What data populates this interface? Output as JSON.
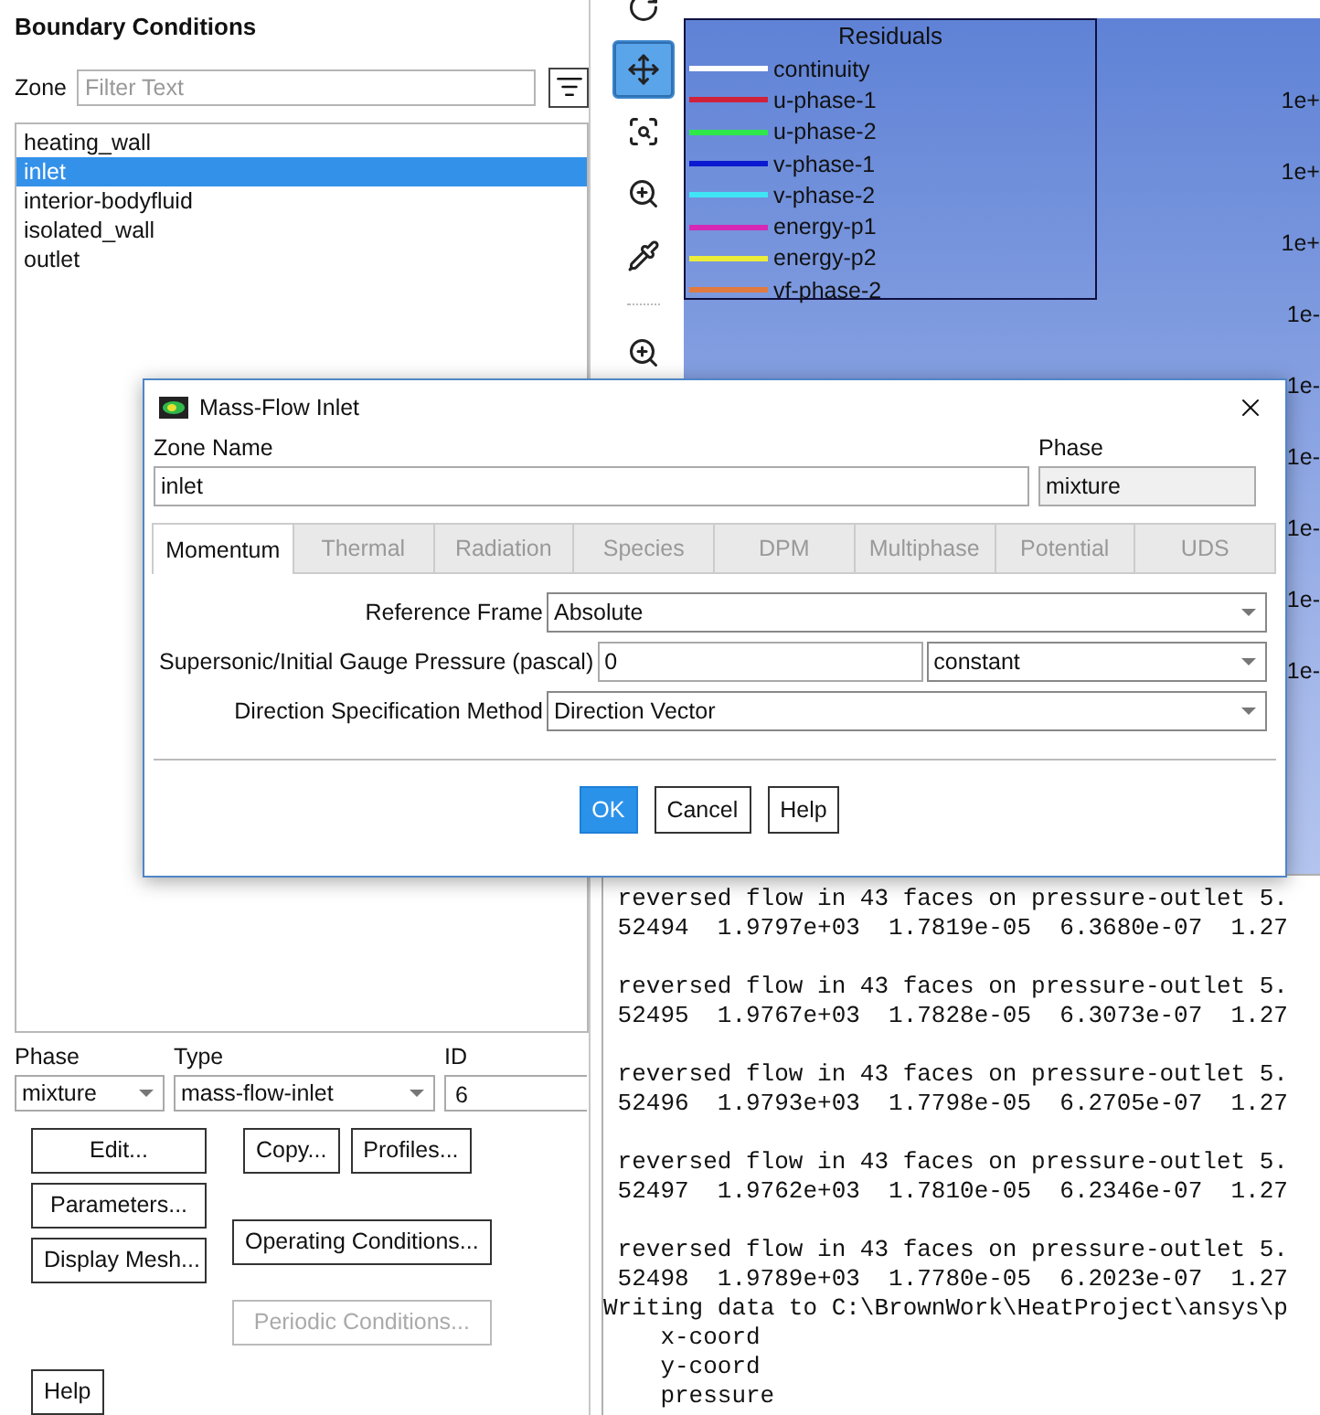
{
  "boundary_panel": {
    "title": "Boundary Conditions",
    "zone_label": "Zone",
    "filter": {
      "placeholder": "Filter Text"
    },
    "zones": [
      {
        "label": "heating_wall",
        "selected": false
      },
      {
        "label": "inlet",
        "selected": true
      },
      {
        "label": "interior-bodyfluid",
        "selected": false
      },
      {
        "label": "isolated_wall",
        "selected": false
      },
      {
        "label": "outlet",
        "selected": false
      }
    ],
    "phase": {
      "label": "Phase",
      "value": "mixture"
    },
    "type": {
      "label": "Type",
      "value": "mass-flow-inlet"
    },
    "id": {
      "label": "ID",
      "value": "6"
    },
    "buttons": [
      {
        "label": "Edit...",
        "disabled": false
      },
      {
        "label": "Parameters...",
        "disabled": false
      },
      {
        "label": "Display Mesh...",
        "disabled": false
      },
      {
        "label": "Copy...",
        "disabled": false
      },
      {
        "label": "Profiles...",
        "disabled": false
      },
      {
        "label": "Operating Conditions...",
        "disabled": false
      },
      {
        "label": "Periodic Conditions...",
        "disabled": true
      },
      {
        "label": "Help",
        "disabled": false
      }
    ]
  },
  "toolbar": [
    {
      "kind": "rotate",
      "selected": false
    },
    {
      "kind": "pan",
      "selected": true
    },
    {
      "kind": "zoom-fit",
      "selected": false
    },
    {
      "kind": "zoom-in",
      "selected": false
    },
    {
      "kind": "probe",
      "selected": false
    },
    {
      "kind": "separator"
    },
    {
      "kind": "zoom-box",
      "selected": false
    }
  ],
  "residuals_plot": {
    "legend_title": "Residuals",
    "legend": [
      {
        "label": "continuity",
        "color": "#ffffff"
      },
      {
        "label": "u-phase-1",
        "color": "#d0213a"
      },
      {
        "label": "u-phase-2",
        "color": "#2ee84a"
      },
      {
        "label": "v-phase-1",
        "color": "#0a1ad0"
      },
      {
        "label": "v-phase-2",
        "color": "#3fe5f5"
      },
      {
        "label": "energy-p1",
        "color": "#d628b4"
      },
      {
        "label": "energy-p2",
        "color": "#ecec3a"
      },
      {
        "label": "vf-phase-2",
        "color": "#e07a40"
      }
    ],
    "axis_labels": [
      "1e+",
      "1e+",
      "1e+",
      "1e-",
      "1e-",
      "1e-",
      "1e-",
      "1e-",
      "1e-"
    ]
  },
  "console": {
    "blocks": [
      {
        "lines": [
          {
            "kind": "message",
            "text": "reversed flow in 43 faces on pressure-outlet 5."
          },
          {
            "kind": "message",
            "text": "52494  1.9797e+03  1.7819e-05  6.3680e-07  1.27"
          }
        ]
      },
      {
        "lines": [
          {
            "kind": "message",
            "text": "reversed flow in 43 faces on pressure-outlet 5."
          },
          {
            "kind": "message",
            "text": "52495  1.9767e+03  1.7828e-05  6.3073e-07  1.27"
          }
        ]
      },
      {
        "lines": [
          {
            "kind": "message",
            "text": "reversed flow in 43 faces on pressure-outlet 5."
          },
          {
            "kind": "message",
            "text": "52496  1.9793e+03  1.7798e-05  6.2705e-07  1.27"
          }
        ]
      },
      {
        "lines": [
          {
            "kind": "message",
            "text": "reversed flow in 43 faces on pressure-outlet 5."
          },
          {
            "kind": "message",
            "text": "52497  1.9762e+03  1.7810e-05  6.2346e-07  1.27"
          }
        ]
      },
      {
        "lines": [
          {
            "kind": "message",
            "text": "reversed flow in 43 faces on pressure-outlet 5."
          },
          {
            "kind": "message",
            "text": "52498  1.9789e+03  1.7780e-05  6.2023e-07  1.27"
          },
          {
            "kind": "plain",
            "text": "Writing data to C:\\BrownWork\\HeatProject\\ansys\\p"
          },
          {
            "kind": "field",
            "text": "x-coord"
          },
          {
            "kind": "field",
            "text": "y-coord"
          },
          {
            "kind": "field",
            "text": "pressure"
          }
        ]
      }
    ]
  },
  "dialog": {
    "title": "Mass-Flow Inlet",
    "zone_name": {
      "label": "Zone Name",
      "value": "inlet"
    },
    "phase": {
      "label": "Phase",
      "value": "mixture"
    },
    "tabs": [
      {
        "label": "Momentum",
        "selected": true,
        "disabled": false
      },
      {
        "label": "Thermal",
        "selected": false,
        "disabled": true
      },
      {
        "label": "Radiation",
        "selected": false,
        "disabled": true
      },
      {
        "label": "Species",
        "selected": false,
        "disabled": true
      },
      {
        "label": "DPM",
        "selected": false,
        "disabled": true
      },
      {
        "label": "Multiphase",
        "selected": false,
        "disabled": true
      },
      {
        "label": "Potential",
        "selected": false,
        "disabled": true
      },
      {
        "label": "UDS",
        "selected": false,
        "disabled": true
      }
    ],
    "fields": [
      {
        "kind": "dropdown",
        "label": "Reference Frame",
        "value": "Absolute"
      },
      {
        "kind": "input_dropdown",
        "label": "Supersonic/Initial Gauge Pressure (pascal)",
        "value": "0",
        "method": "constant"
      },
      {
        "kind": "dropdown",
        "label": "Direction Specification Method",
        "value": "Direction Vector"
      }
    ],
    "buttons": [
      {
        "label": "OK",
        "kind": "primary"
      },
      {
        "label": "Cancel",
        "kind": "normal"
      },
      {
        "label": "Help",
        "kind": "normal"
      }
    ]
  }
}
